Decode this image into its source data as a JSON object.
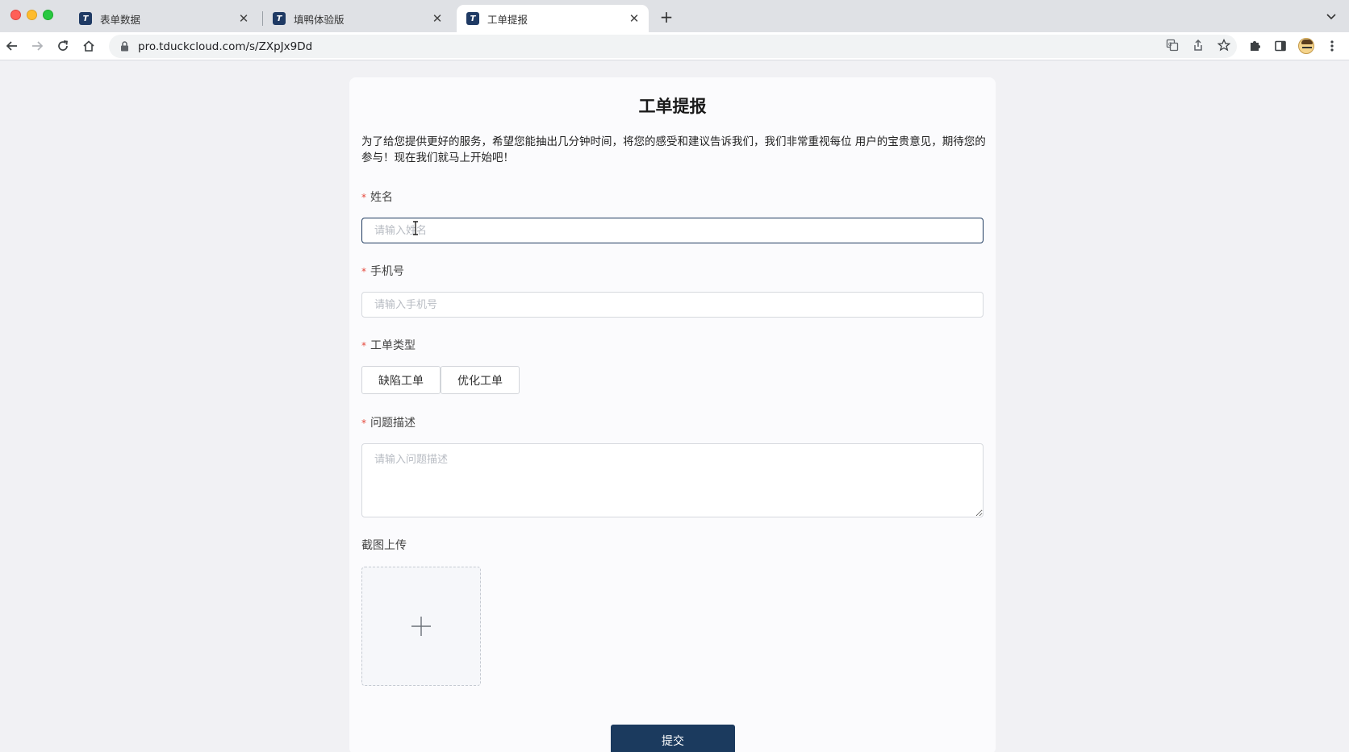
{
  "browser": {
    "tabs": [
      {
        "favicon": "T",
        "title": "表单数据"
      },
      {
        "favicon": "T",
        "title": "填鸭体验版"
      },
      {
        "favicon": "T",
        "title": "工单提报"
      }
    ],
    "url": "pro.tduckcloud.com/s/ZXpJx9Dd"
  },
  "form": {
    "title": "工单提报",
    "description": "为了给您提供更好的服务，希望您能抽出几分钟时间，将您的感受和建议告诉我们，我们非常重视每位 用户的宝贵意见，期待您的参与！现在我们就马上开始吧！",
    "required_mark": "*",
    "name": {
      "label": "姓名",
      "placeholder": "请输入姓名"
    },
    "phone": {
      "label": "手机号",
      "placeholder": "请输入手机号"
    },
    "ticket_type": {
      "label": "工单类型",
      "options": [
        "缺陷工单",
        "优化工单"
      ]
    },
    "problem": {
      "label": "问题描述",
      "placeholder": "请输入问题描述"
    },
    "screenshot": {
      "label": "截图上传"
    },
    "submit_label": "提交"
  },
  "colors": {
    "primary": "#1b3a5e",
    "required": "#e4473b"
  }
}
